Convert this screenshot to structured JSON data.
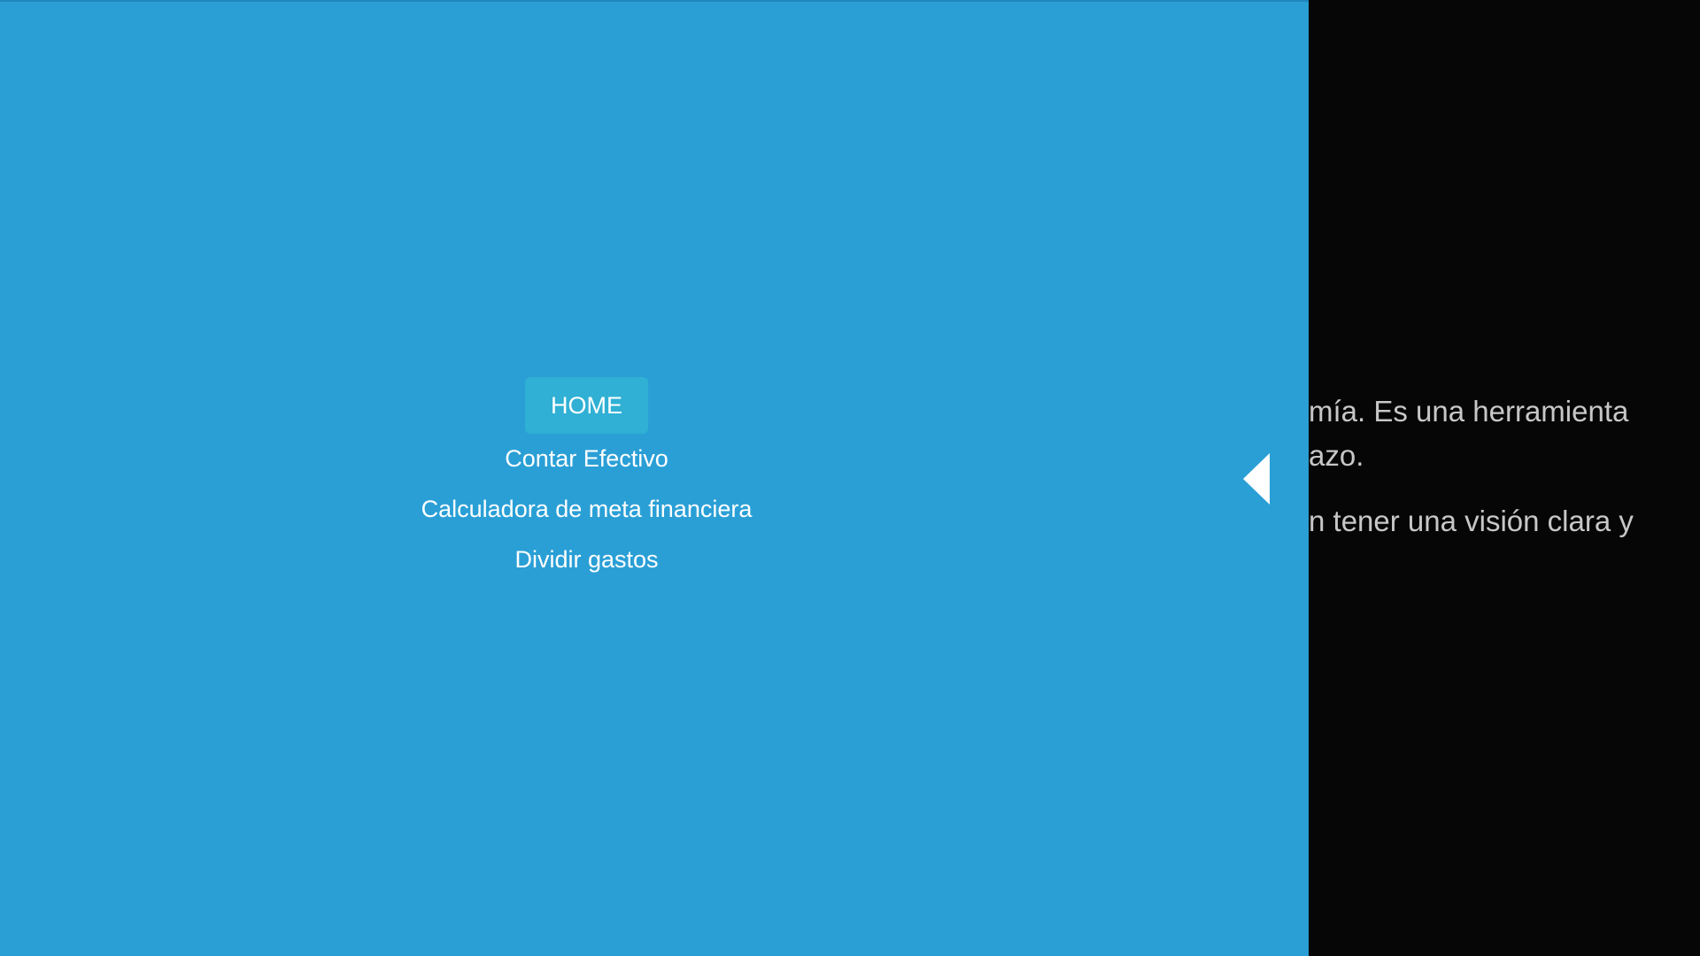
{
  "background_page": {
    "lines": [
      "mía. Es una herramienta",
      "azo.",
      "n tener una visión clara y"
    ]
  },
  "drawer": {
    "menu_items": [
      {
        "label": "HOME",
        "active": true
      },
      {
        "label": "Contar Efectivo",
        "active": false
      },
      {
        "label": "Calculadora de meta financiera",
        "active": false
      },
      {
        "label": "Dividir gastos",
        "active": false
      }
    ],
    "collapse_icon": "triangle-left-icon"
  },
  "colors": {
    "drawer_background": "#2a9fd6",
    "active_item_background": "#2fb0d4",
    "page_background": "#060606",
    "background_text": "#c7c7c7"
  }
}
